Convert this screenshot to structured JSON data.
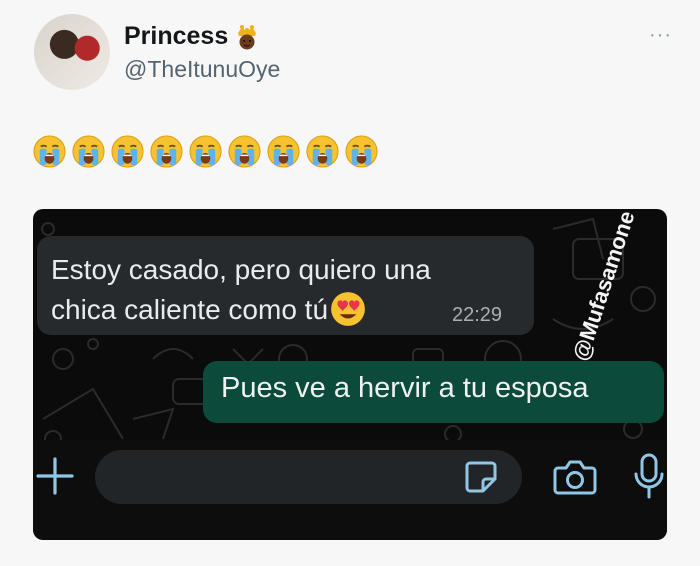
{
  "tweet": {
    "author_name": "Princess",
    "author_handle": "@TheItunuOye",
    "more_label": "···",
    "emojis": [
      "loudly-crying-face",
      "loudly-crying-face",
      "loudly-crying-face",
      "loudly-crying-face",
      "loudly-crying-face",
      "loudly-crying-face",
      "loudly-crying-face",
      "loudly-crying-face",
      "loudly-crying-face"
    ]
  },
  "chat": {
    "incoming": {
      "line1": "Estoy casado, pero quiero una",
      "line2": "chica caliente como tú",
      "emoji": "smiling-face-with-heart-eyes",
      "time": "22:29"
    },
    "outgoing": {
      "text": "Pues ve a hervir a tu esposa"
    },
    "watermark": "@Mufasamone",
    "input_bar": {
      "icons": [
        "plus-icon",
        "sticker-icon",
        "camera-icon",
        "microphone-icon"
      ]
    },
    "colors": {
      "incoming_bubble": "#262a2d",
      "outgoing_bubble": "#0c4a3b",
      "accent_icon": "#8fc7e6"
    }
  }
}
